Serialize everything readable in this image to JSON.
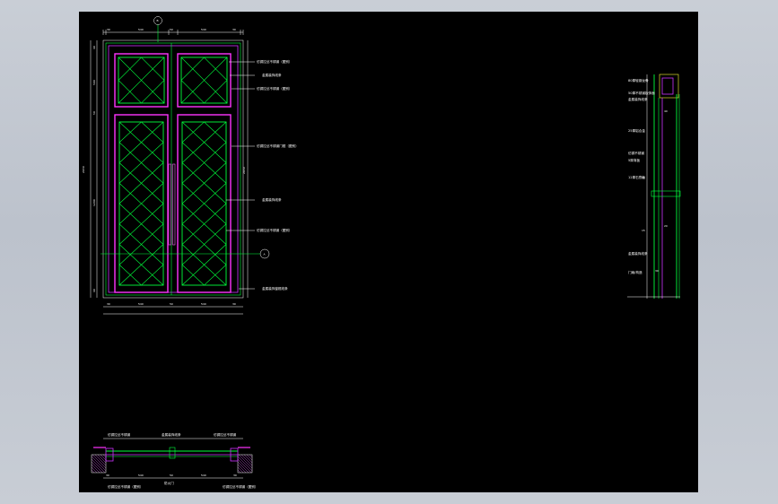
{
  "app": {
    "background_color": "#c6cbd3",
    "canvas_color": "#000000"
  },
  "elevation": {
    "grid_bubble_top": "B",
    "grid_bubble_side": "A",
    "top_dims": [
      "30",
      "540",
      "50",
      "540",
      "30"
    ],
    "bottom_dims": [
      "30",
      "540",
      "50",
      "540",
      "30"
    ],
    "left_total": "2650",
    "right_total": "2650",
    "left_dims": [
      "40",
      "500",
      "50",
      "1200",
      "40"
    ],
    "annotations": [
      "仿铜拉丝不锈钢（图别）",
      "金属装饰线条",
      "仿铜拉丝不锈钢（图别）",
      "仿铜拉丝不锈钢门框（图别）",
      "金属装饰线条",
      "仿铜拉丝不锈钢（图别）",
      "金属装饰窗框线条"
    ]
  },
  "section": {
    "labels": [
      "80厚轻钢龙骨",
      "50厚不锈钢板饰面",
      "金属装饰线条",
      "25厚铝合金",
      "仿铜不锈钢",
      "5厚背板",
      "12厚石膏板",
      "金属装饰线条",
      "门扇/构造"
    ],
    "dims": [
      "30",
      "20",
      "15",
      "40",
      "20"
    ]
  },
  "plan": {
    "top_labels": [
      "仿铜拉丝不锈钢",
      "金属装饰线条",
      "仿铜拉丝不锈钢"
    ],
    "bottom_labels": [
      "仿铜拉丝不锈钢（图别）",
      "防火门",
      "仿铜拉丝不锈钢（图别）"
    ],
    "dims": [
      "30",
      "540",
      "50",
      "540",
      "30"
    ]
  }
}
